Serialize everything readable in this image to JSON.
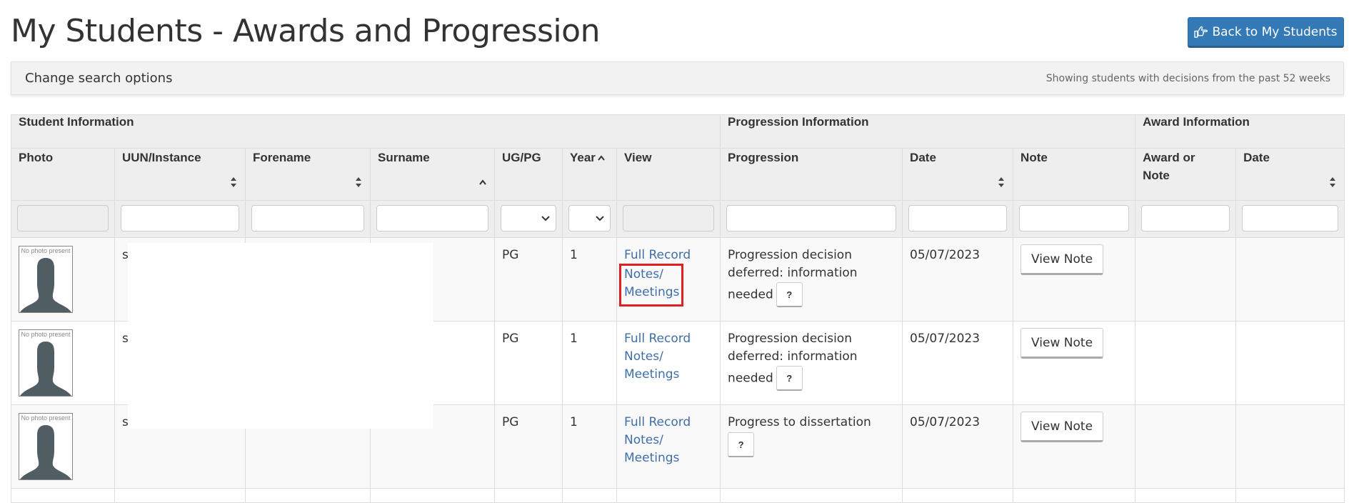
{
  "page": {
    "title": "My Students - Awards and Progression",
    "back_button_label": "Back to My Students",
    "back_button_icon": "hand-pointing-right-icon",
    "accent_color": "#337ab7",
    "highlight_color": "#e02020"
  },
  "search_panel": {
    "toggle_label": "Change search options",
    "status_text": "Showing students with decisions from the past 52 weeks"
  },
  "table": {
    "groups": [
      {
        "label": "Student Information"
      },
      {
        "label": "Progression Information"
      },
      {
        "label": "Award Information"
      }
    ],
    "columns": [
      {
        "label": "Photo",
        "sort": "none",
        "filter": "disabled"
      },
      {
        "label": "UUN/Instance",
        "sort": "sortable",
        "filter": "text"
      },
      {
        "label": "Forename",
        "sort": "sortable",
        "filter": "text"
      },
      {
        "label": "Surname",
        "sort": "ascending",
        "filter": "text"
      },
      {
        "label": "UG/PG",
        "sort": "none",
        "filter": "select"
      },
      {
        "label": "Year",
        "sort": "ascending",
        "filter": "select"
      },
      {
        "label": "View",
        "sort": "none",
        "filter": "disabled"
      },
      {
        "label": "Progression",
        "sort": "none",
        "filter": "text"
      },
      {
        "label": "Date",
        "sort": "sortable",
        "filter": "text"
      },
      {
        "label": "Note",
        "sort": "none",
        "filter": "text"
      },
      {
        "label": "Award or Note",
        "sort": "none",
        "filter": "text"
      },
      {
        "label": "Date",
        "sort": "sortable",
        "filter": "text"
      }
    ],
    "filters": {
      "uun": "",
      "forename": "",
      "surname": "",
      "ug_pg": "",
      "year": "",
      "progression": "",
      "progression_date": "",
      "note": "",
      "award": "",
      "award_date": ""
    },
    "rows": [
      {
        "photo_label": "No photo present",
        "uun": "s",
        "forename": "",
        "surname": "",
        "ug_pg": "PG",
        "year": "1",
        "link_full_record": "Full Record",
        "link_notes": "Notes/ Meetings",
        "progression": "Progression decision deferred: information needed",
        "help_label": "?",
        "date": "05/07/2023",
        "note_button": "View Note",
        "award": "",
        "award_date": ""
      },
      {
        "photo_label": "No photo present",
        "uun": "s",
        "forename": "",
        "surname": "",
        "ug_pg": "PG",
        "year": "1",
        "link_full_record": "Full Record",
        "link_notes": "Notes/ Meetings",
        "progression": "Progression decision deferred: information needed",
        "help_label": "?",
        "date": "05/07/2023",
        "note_button": "View Note",
        "award": "",
        "award_date": ""
      },
      {
        "photo_label": "No photo present",
        "uun": "s",
        "forename": "",
        "surname": "",
        "ug_pg": "PG",
        "year": "1",
        "link_full_record": "Full Record",
        "link_notes": "Notes/ Meetings",
        "progression": "Progress to dissertation",
        "help_label": "?",
        "date": "05/07/2023",
        "note_button": "View Note",
        "award": "",
        "award_date": ""
      }
    ]
  }
}
